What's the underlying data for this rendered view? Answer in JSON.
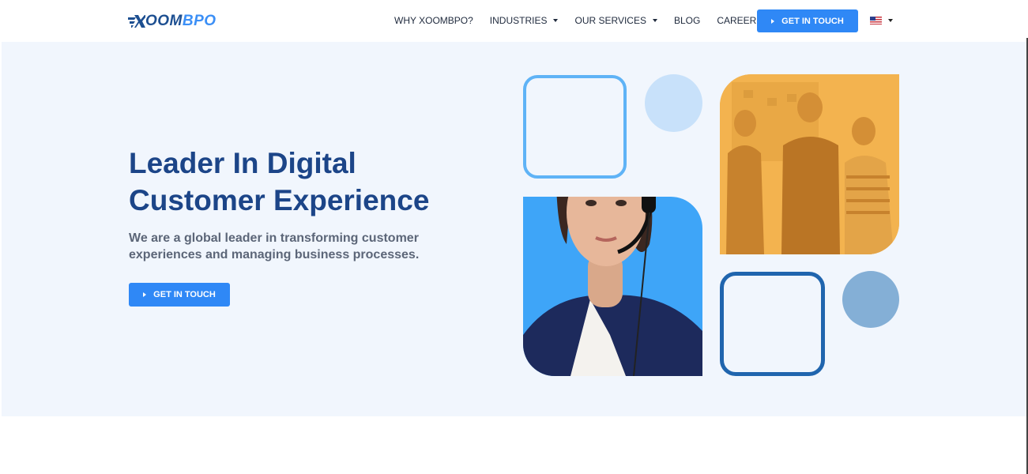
{
  "header": {
    "logo": {
      "text_x": "X",
      "text_oom": "OOM",
      "text_bpo": "BPO"
    },
    "nav": {
      "why": "WHY XOOMBPO?",
      "industries": "INDUSTRIES",
      "services": "OUR SERVICES",
      "blog": "BLOG",
      "careers": "CAREERS"
    },
    "cta_label": "GET IN TOUCH",
    "language": {
      "icon": "us-flag-icon"
    }
  },
  "hero": {
    "title": "Leader In Digital Customer Experience",
    "subtitle": "We are a global leader in transforming customer experiences and managing business processes.",
    "cta_label": "GET IN TOUCH"
  },
  "colors": {
    "brand_dark": "#1c4588",
    "accent": "#2f88f6",
    "hero_bg": "#f1f6fd",
    "sky": "#3ea5f8",
    "orange": "#f3b34f",
    "steel": "#84afd6"
  }
}
